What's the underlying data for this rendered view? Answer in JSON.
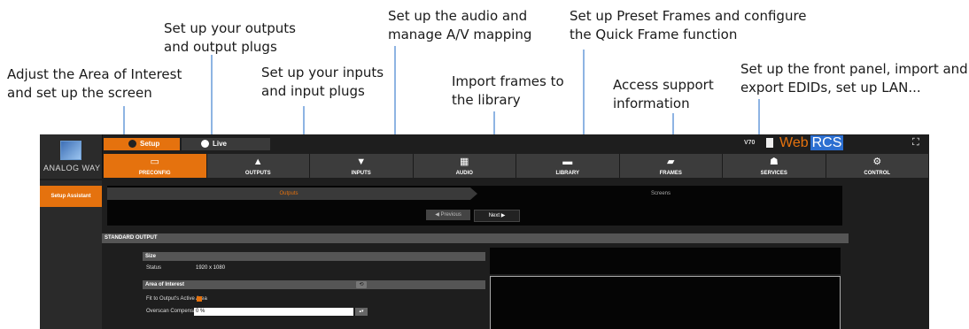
{
  "callouts": {
    "preconfig": [
      "Adjust the Area of Interest",
      "and set up the screen"
    ],
    "outputs": [
      "Set up your outputs",
      "and output plugs"
    ],
    "inputs": [
      "Set up your inputs",
      "and input plugs"
    ],
    "audio": [
      "Set up the audio and",
      "manage A/V mapping"
    ],
    "library": [
      "Import frames to",
      "the library"
    ],
    "frames": [
      "Set up Preset Frames and configure",
      "the Quick Frame function"
    ],
    "services": [
      "Access support",
      "information"
    ],
    "control": [
      "Set up the front panel, import and",
      "export EDIDs, set up  LAN..."
    ]
  },
  "app": {
    "logo_text": "ANALOG WAY",
    "mode_tabs": {
      "setup": "Setup",
      "live": "Live"
    },
    "version": "V70",
    "brand": {
      "web": "Web",
      "rcs": "RCS"
    },
    "expand_glyph": "⛶",
    "nav": [
      {
        "label": "PRECONFIG",
        "glyph": "▭",
        "active": true
      },
      {
        "label": "OUTPUTS",
        "glyph": "▲",
        "active": false
      },
      {
        "label": "INPUTS",
        "glyph": "▼",
        "active": false
      },
      {
        "label": "AUDIO",
        "glyph": "▦",
        "active": false
      },
      {
        "label": "LIBRARY",
        "glyph": "▬",
        "active": false
      },
      {
        "label": "FRAMES",
        "glyph": "▰",
        "active": false
      },
      {
        "label": "SERVICES",
        "glyph": "☗",
        "active": false
      },
      {
        "label": "CONTROL",
        "glyph": "⚙",
        "active": false
      }
    ],
    "sidebar": {
      "item": "Setup Assistant"
    },
    "wizard": {
      "step1": "Outputs",
      "step2": "Screens",
      "prev": "◀ Previous",
      "next": "Next ▶"
    },
    "section_title": "STANDARD OUTPUT",
    "size_section": {
      "header": "Size",
      "status_label": "Status",
      "status_value": "1920 x 1080"
    },
    "aoi_section": {
      "header": "Area of Interest",
      "reset_glyph": "⟲",
      "fit_label": "Fit to Output's Active Area",
      "overscan_label": "Overscan Compensation",
      "overscan_value": "0 %",
      "spin_glyph": "▴▾"
    }
  },
  "colors": {
    "accent": "#e5720e",
    "leader": "#8eb4e3",
    "brand_blue": "#2c6fd1"
  }
}
